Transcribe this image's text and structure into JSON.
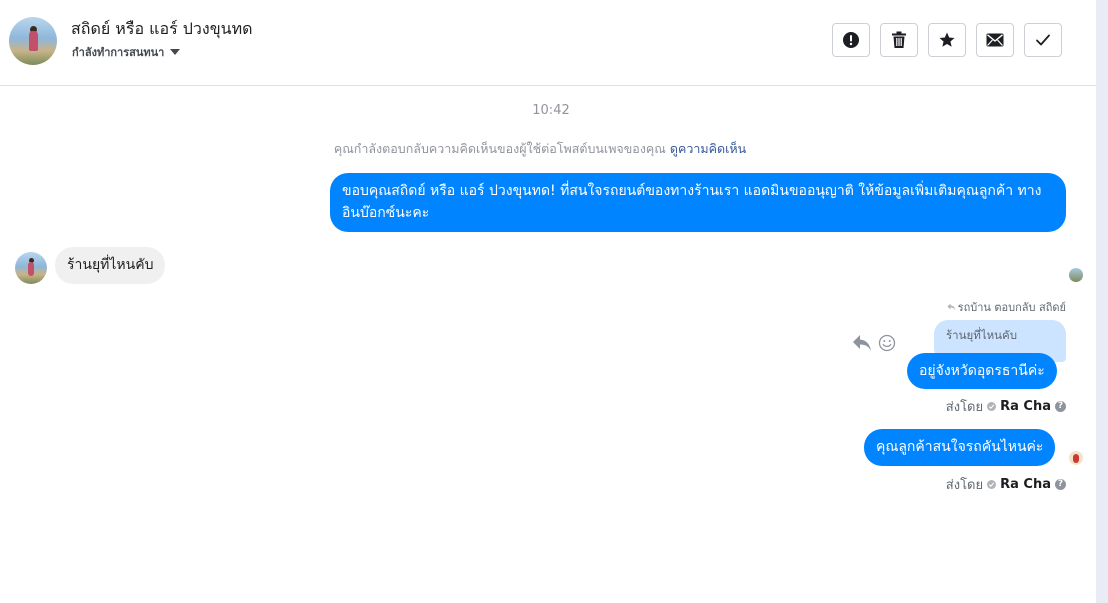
{
  "header": {
    "contact_name": "สถิดย์ หรือ แอร์ ปวงขุนทด",
    "status": "กำลังทำการสนทนา",
    "actions": {
      "spam_icon": "alert-circle-icon",
      "delete_icon": "trash-icon",
      "star_icon": "star-icon",
      "unread_icon": "envelope-icon",
      "done_icon": "check-icon"
    }
  },
  "conversation": {
    "timestamp": "10:42",
    "context_text": "คุณกำลังตอบกลับความคิดเห็นของผู้ใช้ต่อโพสต์บนเพจของคุณ",
    "context_link": "ดูความคิดเห็น",
    "messages": [
      {
        "from": "page",
        "text": "ขอบคุณสถิดย์ หรือ แอร์ ปวงขุนทด! ที่สนใจรถยนต์ของทางร้านเรา แอดมินขออนุญาติ ให้ข้อมูลเพิ่มเติมคุณลูกค้า ทางอินบ๊อกซ์นะคะ"
      },
      {
        "from": "customer",
        "text": "ร้านยุที่ไหนคับ"
      },
      {
        "from": "page",
        "reply_note": "รถบ้าน ตอบกลับ สถิดย์",
        "quoted": "ร้านยุที่ไหนคับ",
        "text": "อยู่จังหวัดอุดรธานีค่ะ",
        "sent_by_label": "ส่งโดย",
        "sent_by_name": "Ra Cha",
        "help": "?"
      },
      {
        "from": "page",
        "text": "คุณลูกค้าสนใจรถคันไหนค่ะ",
        "sent_by_label": "ส่งโดย",
        "sent_by_name": "Ra Cha",
        "help": "?"
      }
    ]
  },
  "colors": {
    "outgoing_bubble": "#0084ff",
    "incoming_bubble": "#f1f0f0",
    "quoted_bubble": "#cce4ff",
    "link": "#365899"
  }
}
